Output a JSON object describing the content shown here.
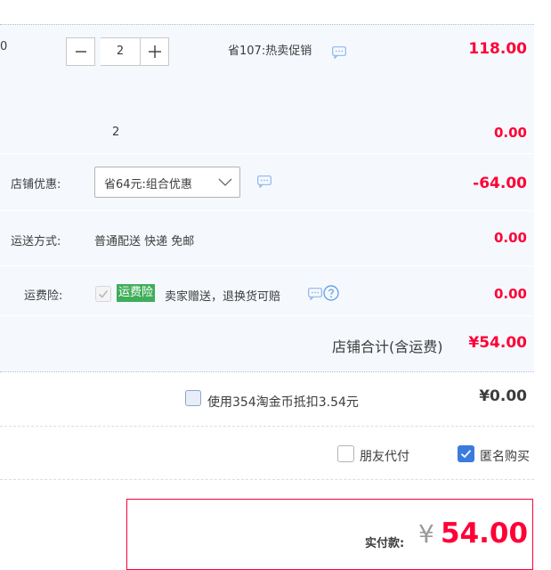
{
  "item": {
    "cut_left_text": "0",
    "quantity": "2",
    "minus_symbol": "−",
    "plus_symbol": "+",
    "promo_text": "省107:热卖促销",
    "price": "118.00"
  },
  "subtotal_row": {
    "quantity": "2",
    "amount": "0.00"
  },
  "shop_discount": {
    "label": "店铺优惠:",
    "selected": "省64元:组合优惠",
    "amount": "-64.00"
  },
  "shipping": {
    "label": "运送方式:",
    "value": "普通配送 快递 免邮",
    "amount": "0.00"
  },
  "shipping_insurance": {
    "label": "运费险:",
    "badge": "运费险",
    "text": "卖家赠送，退换货可赔",
    "amount": "0.00"
  },
  "shop_total": {
    "label": "店铺合计(含运费)",
    "amount": "¥54.00"
  },
  "coins": {
    "label": "使用354淘金币抵扣3.54元",
    "amount": "¥0.00"
  },
  "options": {
    "friend_pay": "朋友代付",
    "anonymous": "匿名购买"
  },
  "payment": {
    "label": "实付款:",
    "currency": "¥",
    "amount": "54.00"
  },
  "colors": {
    "accent_red": "#ff0036",
    "panel_bg": "#f5f9fe",
    "badge_green": "#3fae5a",
    "checkbox_blue": "#3a7be0"
  },
  "icons": [
    "minus-icon",
    "plus-icon",
    "message-icon",
    "chevron-down-icon",
    "help-icon",
    "check-icon"
  ]
}
